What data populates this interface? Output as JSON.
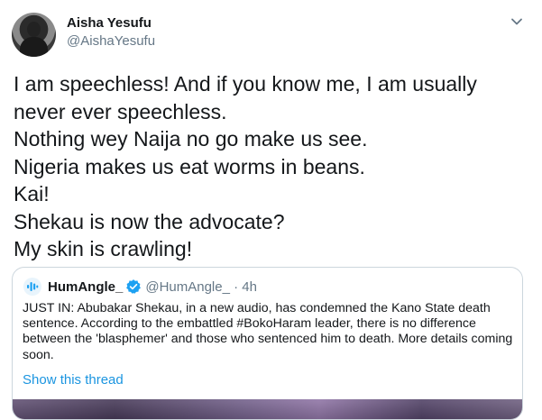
{
  "author": {
    "name": "Aisha Yesufu",
    "handle": "@AishaYesufu"
  },
  "tweet": {
    "lines": [
      "I am speechless! And if you know me, I am usually",
      "never ever speechless.",
      "Nothing wey Naija no go make us see.",
      "Nigeria makes us eat worms in beans.",
      "Kai!",
      "Shekau is now the advocate?",
      "My skin is crawling!"
    ]
  },
  "quoted": {
    "name": "HumAngle_",
    "handle_time": "@HumAngle_ · 4h",
    "text": "JUST IN: Abubakar Shekau, in a new audio, has condemned the Kano State death sentence. According to the embattled #BokoHaram leader, there is no difference between the 'blasphemer' and those who sentenced him to death. More details coming soon.",
    "show_thread": "Show this thread"
  },
  "colors": {
    "accent": "#1b95e0",
    "verified": "#1da1f2",
    "secondary_text": "#657786"
  },
  "icons": {
    "caret": "chevron-down-icon",
    "verified": "verified-badge-icon",
    "logo": "humangle-logo-icon"
  }
}
